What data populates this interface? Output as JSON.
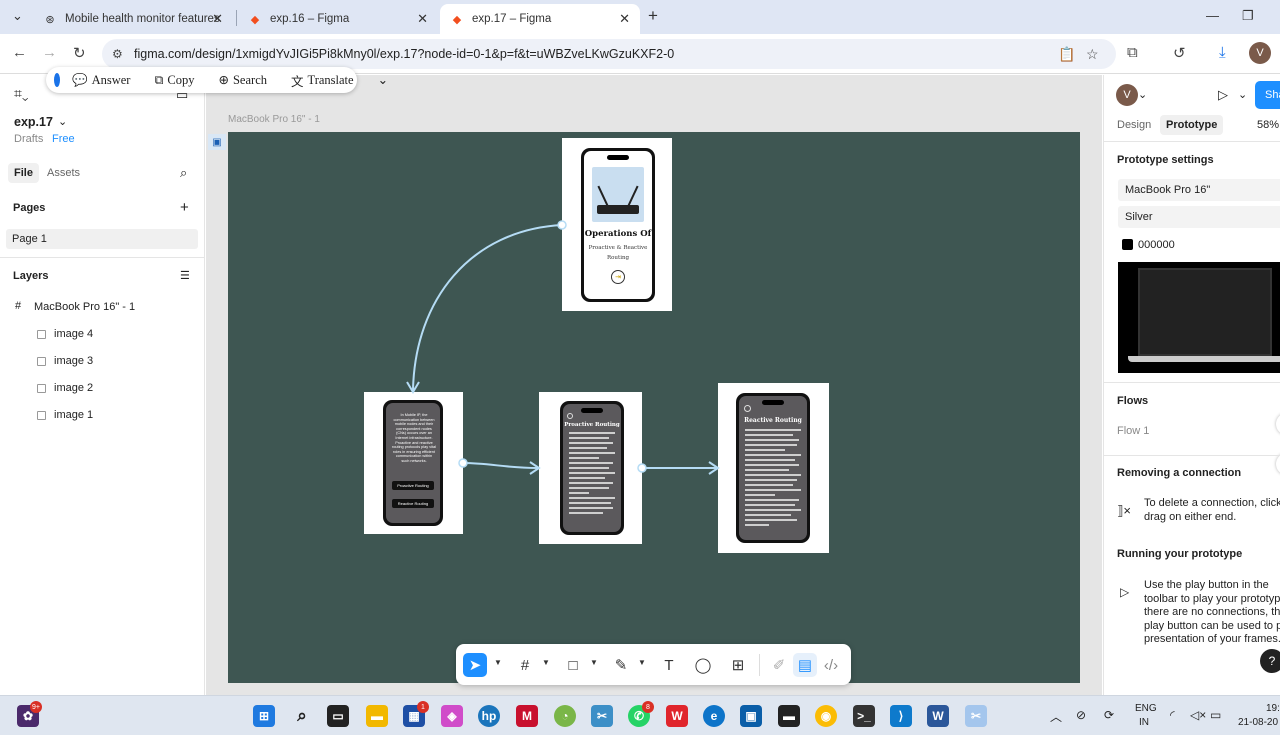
{
  "browser": {
    "tabs": [
      {
        "title": "Mobile health monitor features",
        "icon": "chatgpt-icon"
      },
      {
        "title": "exp.16 – Figma",
        "icon": "figma-icon"
      },
      {
        "title": "exp.17 – Figma",
        "icon": "figma-icon"
      }
    ],
    "url": "figma.com/design/1xmigdYvJIGi5Pi8kMny0l/exp.17?node-id=0-1&p=f&t=uWBZveLKwGzuKXF2-0",
    "profile_initial": "V"
  },
  "ai_toolbar": {
    "answer": "Answer",
    "copy": "Copy",
    "search": "Search",
    "translate": "Translate"
  },
  "left_panel": {
    "file_name": "exp.17",
    "drafts": "Drafts",
    "plan": "Free",
    "tab_file": "File",
    "tab_assets": "Assets",
    "pages_heading": "Pages",
    "page": "Page 1",
    "layers_heading": "Layers",
    "frame_layer": "MacBook Pro 16\" - 1",
    "layers": [
      "image 4",
      "image 3",
      "image 2",
      "image 1"
    ]
  },
  "canvas": {
    "frame_label": "MacBook Pro 16\" - 1",
    "frame_color": "#3e5652",
    "screen1": {
      "title": "Operations Of",
      "subtitle": "Proactive & Reactive Routing"
    },
    "screen2": {
      "intro": "In Mobile IP, the communication between mobile nodes and their correspondent nodes (CNs) occurs over an Internet infrastructure. Proactive and reactive routing protocols play vital roles in ensuring efficient communication within such networks.",
      "btn1": "Proactive Routing",
      "btn2": "Reactive Routing"
    },
    "screen3": {
      "title": "Proactive Routing"
    },
    "screen4": {
      "title": "Reactive Routing"
    }
  },
  "right_panel": {
    "avatar": "V",
    "share": "Sha",
    "tab_design": "Design",
    "tab_prototype": "Prototype",
    "zoom": "58%",
    "prototype_settings": "Prototype settings",
    "device": "MacBook Pro 16\"",
    "model": "Silver",
    "bg_color": "000000",
    "flows": "Flows",
    "flow": "Flow 1",
    "removing_heading": "Removing a connection",
    "removing_text_1": "To delete a connection, click a",
    "removing_text_2": "drag on either end.",
    "running_heading": "Running your prototype",
    "running_text": [
      "Use the play button in the",
      "toolbar to play your prototype.",
      "there are no connections, the",
      "play button can be used to pla",
      "presentation of your frames."
    ]
  },
  "taskbar": {
    "language": "ENG",
    "region": "IN",
    "time": "19:",
    "date": "21-08-20",
    "notif_badge": "9+",
    "badge_office": "1",
    "badge_whatsapp": "8"
  }
}
